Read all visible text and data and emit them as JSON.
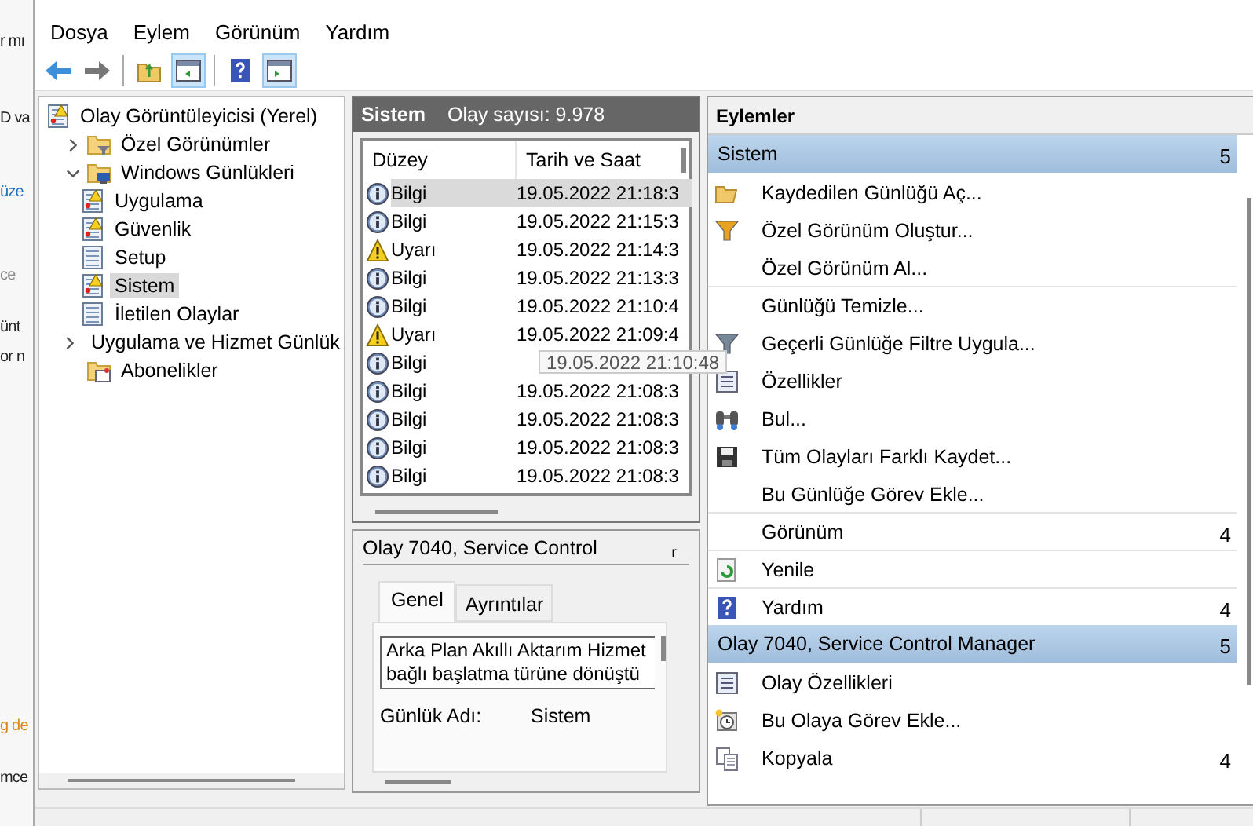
{
  "background_window": {
    "fragments": [
      {
        "text": "r mı",
        "kind": "plain"
      },
      {
        "text": "D va",
        "kind": "plain"
      },
      {
        "text": "üze",
        "kind": "link"
      },
      {
        "text": "ce",
        "kind": "hint"
      },
      {
        "text": "ünt",
        "kind": "plain"
      },
      {
        "text": "or n",
        "kind": "plain"
      },
      {
        "text": "g de",
        "kind": "warning"
      },
      {
        "text": "mce",
        "kind": "plain"
      }
    ]
  },
  "menu": [
    "Dosya",
    "Eylem",
    "Görünüm",
    "Yardım"
  ],
  "toolbar": [
    {
      "kind": "back",
      "selected": false
    },
    {
      "kind": "forward",
      "selected": false
    },
    {
      "kind": "separator"
    },
    {
      "kind": "up",
      "selected": false
    },
    {
      "kind": "console-tree",
      "selected": true
    },
    {
      "kind": "separator"
    },
    {
      "kind": "help",
      "selected": false
    },
    {
      "kind": "action-pane",
      "selected": true
    }
  ],
  "tree": [
    {
      "label": "Olay Görüntüleyicisi (Yerel)",
      "kind": "viewer",
      "selected": false,
      "children": [
        {
          "label": "Özel Görünümler",
          "kind": "filterfolder",
          "expanded": false,
          "selected": false
        },
        {
          "label": "Windows Günlükleri",
          "kind": "computerfolder",
          "expanded": true,
          "selected": false,
          "children": [
            {
              "label": "Uygulama",
              "kind": "warnlog",
              "selected": false
            },
            {
              "label": "Güvenlik",
              "kind": "warnlog",
              "selected": false
            },
            {
              "label": "Setup",
              "kind": "log",
              "selected": false
            },
            {
              "label": "Sistem",
              "kind": "warnlog",
              "selected": true
            },
            {
              "label": "İletilen Olaylar",
              "kind": "log",
              "selected": false
            }
          ]
        },
        {
          "label": "Uygulama ve Hizmet Günlük",
          "kind": "logfolder",
          "expanded": false,
          "selected": false
        },
        {
          "label": "Abonelikler",
          "kind": "subscriptionfolder",
          "selected": false
        }
      ]
    }
  ],
  "events": {
    "title": "Sistem",
    "count": "Olay sayısı: 9.978",
    "columns": [
      "Düzey",
      "Tarih ve Saat"
    ],
    "rows": [
      {
        "kind": "info",
        "label": "Bilgi",
        "date": "19.05.2022 21:18:3",
        "selected": true
      },
      {
        "kind": "info",
        "label": "Bilgi",
        "date": "19.05.2022 21:15:3",
        "selected": false
      },
      {
        "kind": "warning",
        "label": "Uyarı",
        "date": "19.05.2022 21:14:3",
        "selected": false
      },
      {
        "kind": "info",
        "label": "Bilgi",
        "date": "19.05.2022 21:13:3",
        "selected": false
      },
      {
        "kind": "info",
        "label": "Bilgi",
        "date": "19.05.2022 21:10:4",
        "selected": false
      },
      {
        "kind": "warning",
        "label": "Uyarı",
        "date": "19.05.2022 21:09:4",
        "selected": false
      },
      {
        "kind": "info",
        "label": "Bilgi",
        "selected": false
      },
      {
        "kind": "info",
        "label": "Bilgi",
        "date": "19.05.2022 21:08:3",
        "selected": false
      },
      {
        "kind": "info",
        "label": "Bilgi",
        "date": "19.05.2022 21:08:3",
        "selected": false
      },
      {
        "kind": "info",
        "label": "Bilgi",
        "date": "19.05.2022 21:08:3",
        "selected": false
      },
      {
        "kind": "info",
        "label": "Bilgi",
        "date": "19.05.2022 21:08:3",
        "selected": false
      }
    ],
    "tooltip": "19.05.2022 21:10:48"
  },
  "details": {
    "title": "Olay 7040, Service Control",
    "title_tail": "r",
    "tabs": [
      {
        "label": "Genel",
        "selected": true
      },
      {
        "label": "Ayrıntılar",
        "selected": false
      }
    ],
    "description": [
      "Arka Plan Akıllı Aktarım Hizmet",
      "bağlı başlatma türüne dönüştü"
    ],
    "fields": [
      {
        "label": "Günlük Adı:",
        "value": "Sistem"
      }
    ]
  },
  "actions": {
    "title": "Eylemler",
    "sections": [
      {
        "title": "Sistem",
        "count": "5",
        "items": [
          {
            "label": "Kaydedilen Günlüğü Aç...",
            "kind": "open",
            "divider": false
          },
          {
            "label": "Özel Görünüm Oluştur...",
            "kind": "createview",
            "divider": false
          },
          {
            "label": "Özel Görünüm Al...",
            "kind": "plain",
            "divider": false
          },
          {
            "label": "Günlüğü Temizle...",
            "kind": "plain",
            "divider": true
          },
          {
            "label": "Geçerli Günlüğe Filtre Uygula...",
            "kind": "filter",
            "divider": false
          },
          {
            "label": "Özellikler",
            "kind": "properties",
            "divider": false
          },
          {
            "label": "Bul...",
            "kind": "find",
            "divider": false
          },
          {
            "label": "Tüm Olayları Farklı Kaydet...",
            "kind": "save",
            "divider": false
          },
          {
            "label": "Bu Günlüğe Görev Ekle...",
            "kind": "plain",
            "divider": false
          },
          {
            "label": "Görünüm",
            "kind": "plain",
            "divider": true,
            "submenu": "4"
          },
          {
            "label": "Yenile",
            "kind": "refresh",
            "divider": true
          },
          {
            "label": "Yardım",
            "kind": "help",
            "divider": true,
            "submenu": "4"
          }
        ]
      },
      {
        "title": "Olay 7040, Service Control Manager",
        "count": "5",
        "items": [
          {
            "label": "Olay Özellikleri",
            "kind": "properties",
            "divider": false
          },
          {
            "label": "Bu Olaya Görev Ekle...",
            "kind": "task",
            "divider": false
          },
          {
            "label": "Kopyala",
            "kind": "copy",
            "divider": false,
            "submenu": "4"
          }
        ]
      }
    ]
  }
}
